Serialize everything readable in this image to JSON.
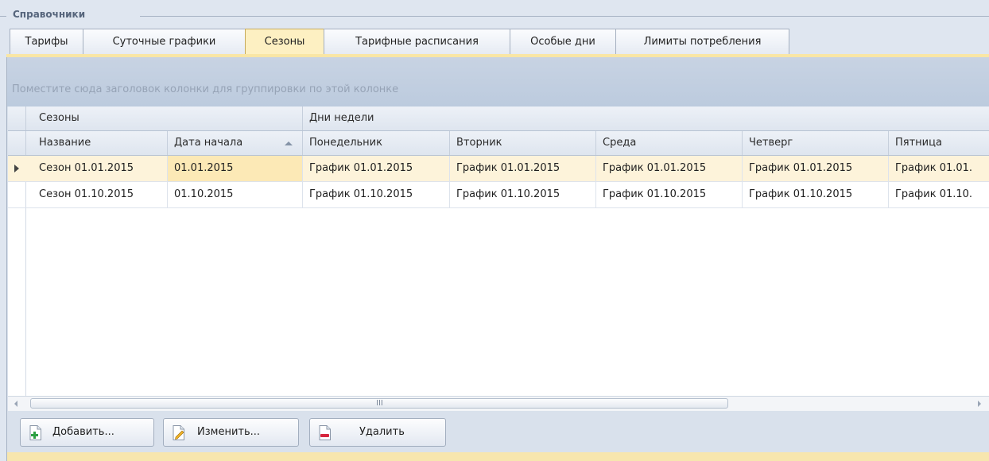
{
  "group": {
    "title": "Справочники"
  },
  "tabs": [
    {
      "label": "Тарифы",
      "active": false
    },
    {
      "label": "Суточные графики",
      "active": false
    },
    {
      "label": "Сезоны",
      "active": true
    },
    {
      "label": "Тарифные расписания",
      "active": false
    },
    {
      "label": "Особые дни",
      "active": false
    },
    {
      "label": "Лимиты потребления",
      "active": false
    }
  ],
  "grid": {
    "group_panel_hint": "Поместите сюда заголовок колонки для группировки по этой колонке",
    "bands": [
      "Сезоны",
      "Дни недели"
    ],
    "columns": [
      "Название",
      "Дата начала",
      "Понедельник",
      "Вторник",
      "Среда",
      "Четверг",
      "Пятница"
    ],
    "sort_column": "Дата начала",
    "rows": [
      [
        "Сезон 01.01.2015",
        "01.01.2015",
        "График 01.01.2015",
        "График 01.01.2015",
        "График 01.01.2015",
        "График 01.01.2015",
        "График 01.01."
      ],
      [
        "Сезон 01.10.2015",
        "01.10.2015",
        "График 01.10.2015",
        "График 01.10.2015",
        "График 01.10.2015",
        "График 01.10.2015",
        "График 01.10."
      ]
    ],
    "focused_row": 0
  },
  "scrollbar": {
    "grip": "III"
  },
  "buttons": {
    "add": {
      "label": "Добавить...",
      "icon": "add-document-icon"
    },
    "edit": {
      "label": "Изменить...",
      "icon": "edit-document-icon"
    },
    "delete": {
      "label": "Удалить",
      "icon": "delete-document-icon"
    }
  },
  "colors": {
    "active_tab": "#fdf0c2",
    "focused_row": "#fdf3da",
    "accent_strip": "#f7e6ae"
  }
}
